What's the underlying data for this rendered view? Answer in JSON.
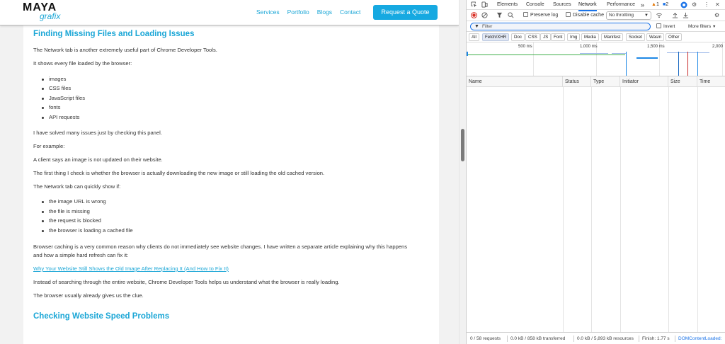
{
  "site": {
    "logo_top": "MAYA",
    "logo_bottom": "grafix",
    "nav": [
      "Services",
      "Portfolio",
      "Blogs",
      "Contact"
    ],
    "cta": "Request a Quote",
    "heading1": "Finding Missing Files and Loading Issues",
    "p1": "The Network tab is another extremely useful part of Chrome Developer Tools.",
    "p2": "It shows every file loaded by the browser:",
    "list1": [
      "images",
      "CSS files",
      "JavaScript files",
      "fonts",
      "API requests"
    ],
    "p3": "I have solved many issues just by checking this panel.",
    "p4": "For example:",
    "p5": "A client says an image is not updated on their website.",
    "p6": "The first thing I check is whether the browser is actually downloading the new image or still loading the old cached version.",
    "p7": "The Network tab can quickly show if:",
    "list2": [
      "the image URL is wrong",
      "the file is missing",
      "the request is blocked",
      "the browser is loading a cached file"
    ],
    "p8": "Browser caching is a very common reason why clients do not immediately see website changes. I have written a separate article explaining why this happens and how a simple hard refresh can fix it:",
    "link": "Why Your Website Still Shows the Old Image After Replacing It (And How to Fix It)",
    "p9": "Instead of searching through the entire website, Chrome Developer Tools helps us understand what the browser is really loading.",
    "p10": "The browser usually already gives us the clue.",
    "heading2": "Checking Website Speed Problems"
  },
  "devtools": {
    "tabs": [
      "Elements",
      "Console",
      "Sources",
      "Network",
      "Performance"
    ],
    "more": "»",
    "warnings": "1",
    "issues": "2",
    "preserve_log": "Preserve log",
    "disable_cache": "Disable cache",
    "throttle": "No throttling",
    "filter_placeholder": "Filter",
    "invert": "Invert",
    "more_filters": "More filters",
    "types": [
      "All",
      "Fetch/XHR",
      "Doc",
      "CSS",
      "JS",
      "Font",
      "Img",
      "Media",
      "Manifest",
      "Socket",
      "Wasm",
      "Other"
    ],
    "active_type": "Fetch/XHR",
    "timeline_ticks": [
      "500 ms",
      "1,000 ms",
      "1,500 ms",
      "2,000"
    ],
    "columns": [
      "Name",
      "Status",
      "Type",
      "Initiator",
      "Size",
      "Time"
    ],
    "status": {
      "requests": "0 / 58 requests",
      "transferred": "0.0 kB / 858 kB transferred",
      "resources": "0.0 kB / 5,893 kB resources",
      "finish": "Finish: 1.77 s",
      "dom": "DOMContentLoaded:"
    },
    "colors": {
      "accent": "#1a73e8",
      "load_line": "#c62828",
      "dom_line": "#1565c0",
      "bar_green": "#3fae49",
      "bar_blue": "#1e88e5"
    }
  }
}
